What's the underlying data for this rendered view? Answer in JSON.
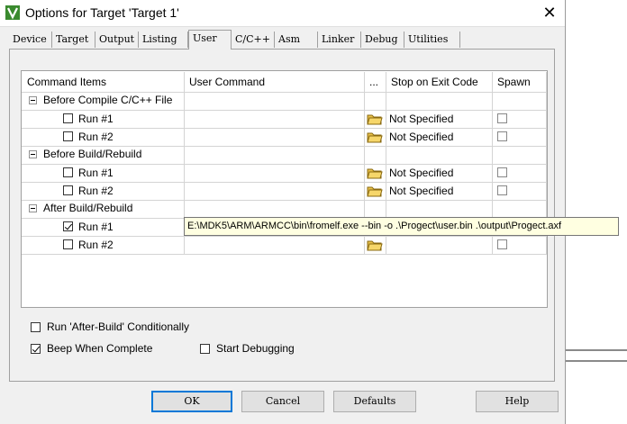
{
  "window": {
    "title": "Options for Target 'Target 1'",
    "icons": {
      "app": "keil-icon",
      "close": "close-icon"
    },
    "close_glyph": "✕"
  },
  "tabs": [
    {
      "label": "Device",
      "active": false
    },
    {
      "label": "Target",
      "active": false
    },
    {
      "label": "Output",
      "active": false
    },
    {
      "label": "Listing",
      "active": false
    },
    {
      "label": "User",
      "active": true
    },
    {
      "label": "C/C++",
      "active": false
    },
    {
      "label": "Asm",
      "active": false
    },
    {
      "label": "Linker",
      "active": false
    },
    {
      "label": "Debug",
      "active": false
    },
    {
      "label": "Utilities",
      "active": false
    }
  ],
  "grid": {
    "headers": {
      "command_items": "Command Items",
      "user_command": "User Command",
      "browse": "...",
      "stop_on_exit": "Stop on Exit Code",
      "spawn": "Spawn"
    },
    "groups": [
      {
        "label": "Before Compile C/C++ File",
        "items": [
          {
            "label": "Run #1",
            "checked": false,
            "command": "",
            "stop": "Not Specified",
            "spawn": false
          },
          {
            "label": "Run #2",
            "checked": false,
            "command": "",
            "stop": "Not Specified",
            "spawn": false
          }
        ]
      },
      {
        "label": "Before Build/Rebuild",
        "items": [
          {
            "label": "Run #1",
            "checked": false,
            "command": "",
            "stop": "Not Specified",
            "spawn": false
          },
          {
            "label": "Run #2",
            "checked": false,
            "command": "",
            "stop": "Not Specified",
            "spawn": false
          }
        ]
      },
      {
        "label": "After Build/Rebuild",
        "items": [
          {
            "label": "Run #1",
            "checked": true,
            "command": "E:\\MDK5\\ARM\\ARMCC\\bin\\fromelf.exe  --bin -o  .\\Progect\\user.bin  .\\output\\Progect.axf",
            "stop": "",
            "spawn": false
          },
          {
            "label": "Run #2",
            "checked": false,
            "command": "",
            "stop": "",
            "spawn": false
          }
        ]
      }
    ]
  },
  "options": {
    "run_after_build": {
      "label": "Run 'After-Build' Conditionally",
      "checked": false
    },
    "beep": {
      "label": "Beep When Complete",
      "checked": true
    },
    "start_debugging": {
      "label": "Start Debugging",
      "checked": false
    }
  },
  "buttons": {
    "ok": "OK",
    "cancel": "Cancel",
    "defaults": "Defaults",
    "help": "Help"
  }
}
